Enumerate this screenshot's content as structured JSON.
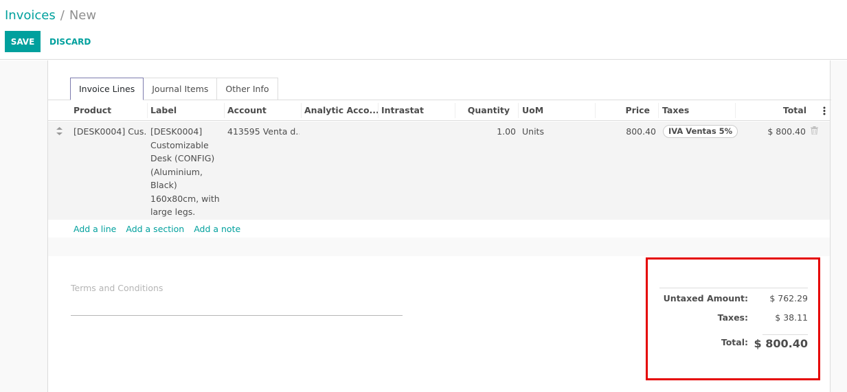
{
  "breadcrumb": {
    "parent": "Invoices",
    "separator": "/",
    "current": "New"
  },
  "toolbar": {
    "save_label": "SAVE",
    "discard_label": "DISCARD"
  },
  "tabs": [
    {
      "label": "Invoice Lines",
      "active": true
    },
    {
      "label": "Journal Items",
      "active": false
    },
    {
      "label": "Other Info",
      "active": false
    }
  ],
  "table": {
    "columns": [
      "Product",
      "Label",
      "Account",
      "Analytic Acco...",
      "Intrastat",
      "Quantity",
      "UoM",
      "Price",
      "Taxes",
      "Total"
    ],
    "rows": [
      {
        "product": "[DESK0004] Cus...",
        "label_lines": [
          "[DESK0004]",
          "Customizable",
          "Desk (CONFIG)",
          "(Aluminium,",
          "Black)",
          "160x80cm, with",
          "large legs."
        ],
        "account": "413595 Venta d...",
        "analytic": "",
        "intrastat": "",
        "quantity": "1.00",
        "uom": "Units",
        "price": "800.40",
        "tax": "IVA Ventas 5%",
        "total": "$ 800.40"
      }
    ],
    "add_links": [
      "Add a line",
      "Add a section",
      "Add a note"
    ],
    "options_icon": "vertical-dots-icon",
    "handle_icon": "drag-handle-icon",
    "delete_icon": "trash-icon"
  },
  "terms_placeholder": "Terms and Conditions",
  "totals": {
    "untaxed_label": "Untaxed Amount:",
    "untaxed_value": "$ 762.29",
    "taxes_label": "Taxes:",
    "taxes_value": "$ 38.11",
    "total_label": "Total:",
    "total_value": "$ 800.40"
  },
  "colors": {
    "accent": "#00a09d",
    "highlight": "#e50000",
    "active_tab_border": "#7c7bad"
  }
}
